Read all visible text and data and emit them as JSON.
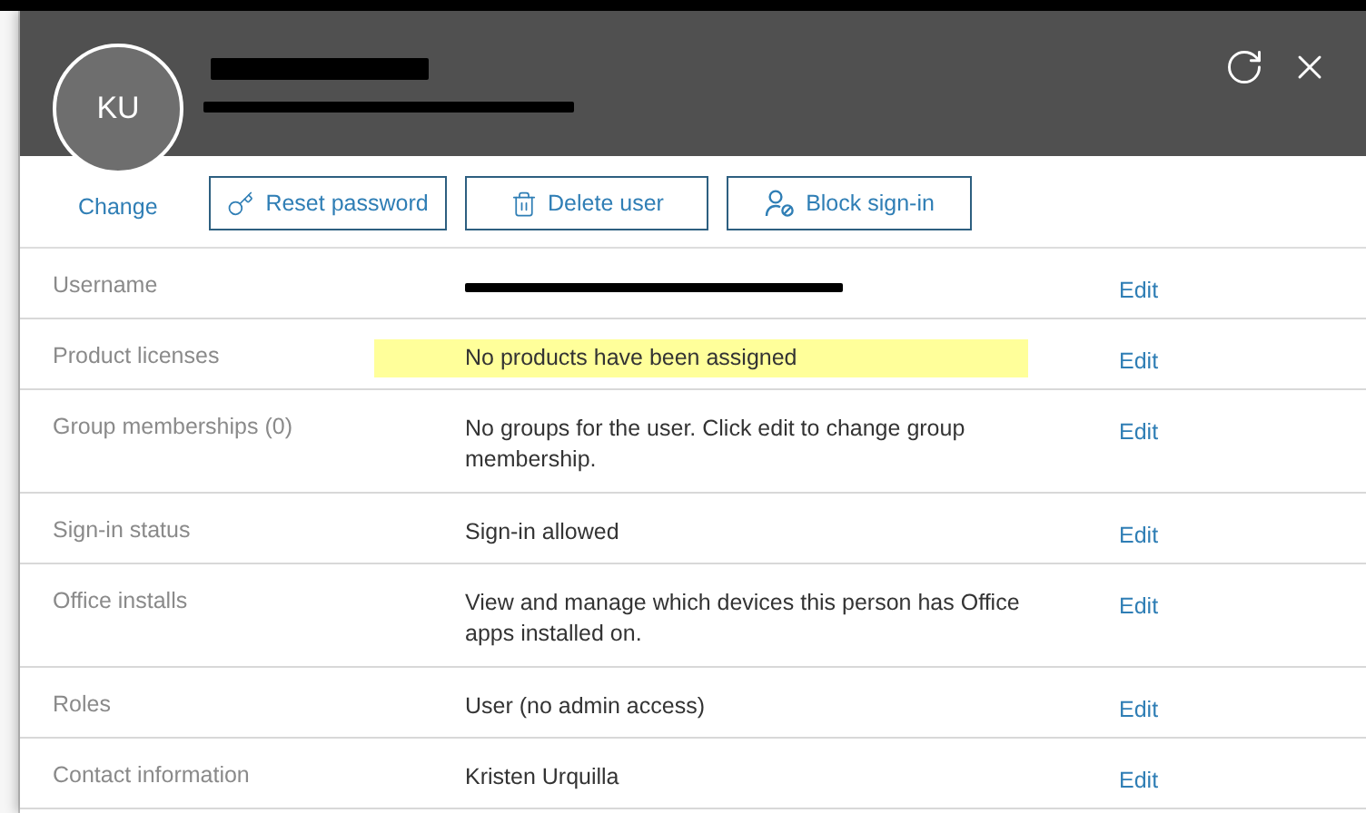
{
  "header": {
    "avatar_initials": "KU",
    "name_redacted": true,
    "email_redacted": true
  },
  "change_link": "Change",
  "actions": [
    {
      "label": "Reset password",
      "kind": "reset"
    },
    {
      "label": "Delete user",
      "kind": "delete"
    },
    {
      "label": "Block sign-in",
      "kind": "block"
    }
  ],
  "rows": [
    {
      "label": "Username",
      "redacted": true,
      "action": "Edit"
    },
    {
      "label": "Product licenses",
      "value": "No products have been assigned",
      "highlighted": true,
      "action": "Edit"
    },
    {
      "label": "Group memberships (0)",
      "value": "No groups for the user. Click edit to change group membership.",
      "highlighted": false,
      "action": "Edit"
    },
    {
      "label": "Sign-in status",
      "value": "Sign-in allowed",
      "highlighted": false,
      "action": "Edit"
    },
    {
      "label": "Office installs",
      "value": "View and manage which devices this person has Office apps installed on.",
      "highlighted": false,
      "action": "Edit"
    },
    {
      "label": "Roles",
      "value": "User (no admin access)",
      "highlighted": false,
      "action": "Edit"
    },
    {
      "label": "Contact information",
      "value": "Kristen Urquilla",
      "highlighted": false,
      "action": "Edit"
    }
  ]
}
